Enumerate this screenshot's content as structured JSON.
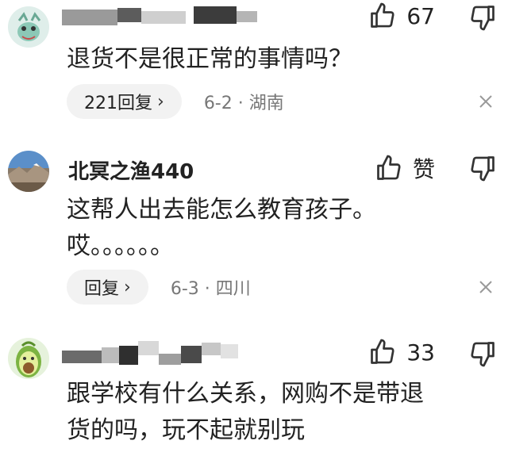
{
  "comments": [
    {
      "user": "",
      "like_count": "67",
      "text_lines": [
        "退货不是很正常的事情吗？"
      ],
      "reply_label": "221回复",
      "date_location": "6-2 · 湖南"
    },
    {
      "user": "北冥之渔440",
      "like_count": "赞",
      "text_lines": [
        "这帮人出去能怎么教育孩子。",
        "哎。。。。。。"
      ],
      "reply_label": "回复",
      "date_location": "6-3 · 四川"
    },
    {
      "user": "",
      "like_count": "33",
      "text_lines": [
        "跟学校有什么关系，网购不是带退",
        "货的吗，玩不起就别玩"
      ]
    }
  ],
  "icons": {
    "like": "thumbs-up-icon",
    "dislike": "thumbs-down-icon",
    "close": "close-icon",
    "chevron": "chevron-right-icon"
  },
  "colors": {
    "meta_text": "#777777",
    "reply_bg": "#f2f2f2"
  }
}
